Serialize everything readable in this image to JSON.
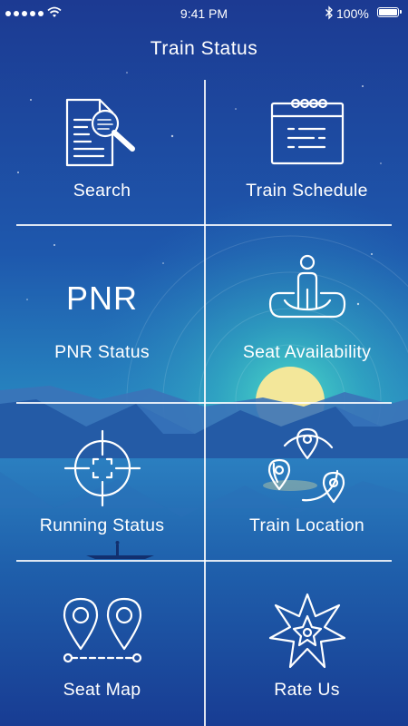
{
  "status_bar": {
    "time": "9:41 PM",
    "battery": "100%"
  },
  "header": {
    "title": "Train Status"
  },
  "menu": {
    "search": {
      "label": "Search",
      "icon": "search-document-icon"
    },
    "train_schedule": {
      "label": "Train Schedule",
      "icon": "calendar-icon"
    },
    "pnr_status": {
      "label": "PNR Status",
      "icon_text": "PNR"
    },
    "seat_availability": {
      "label": "Seat Availability",
      "icon": "person-seat-icon"
    },
    "running_status": {
      "label": "Running Status",
      "icon": "crosshair-icon"
    },
    "train_location": {
      "label": "Train Location",
      "icon": "location-pins-icon"
    },
    "seat_map": {
      "label": "Seat Map",
      "icon": "map-pins-route-icon"
    },
    "rate_us": {
      "label": "Rate Us",
      "icon": "star-badge-icon"
    }
  },
  "colors": {
    "sky_top": "#1c3f96",
    "sky_mid": "#1e6ab5",
    "glow": "#38c6c4",
    "sun": "#f4e79a",
    "water": "#1b5aa6"
  }
}
